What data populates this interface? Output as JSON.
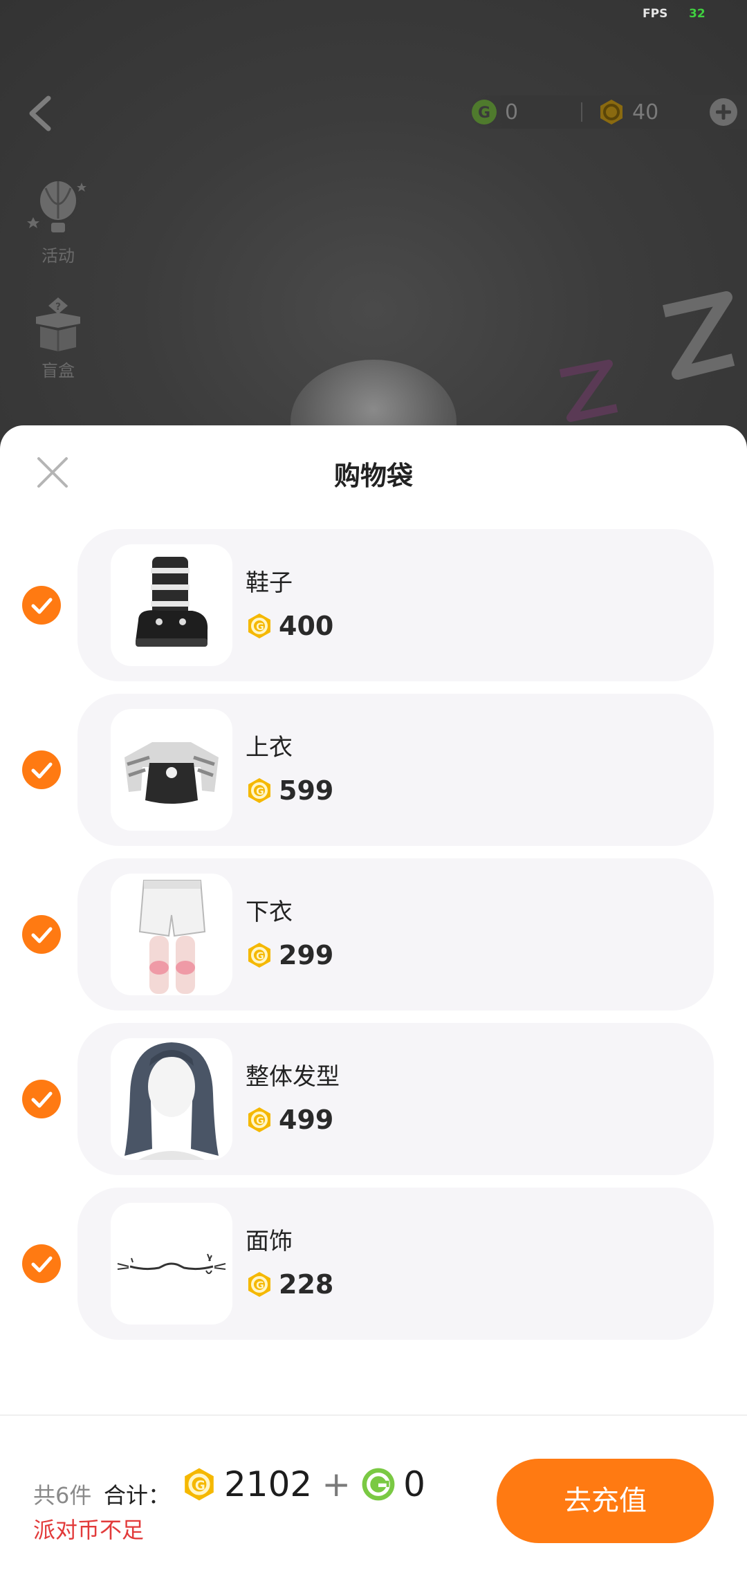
{
  "status": {
    "fps_label": "FPS",
    "fps_value": "32"
  },
  "topbar": {
    "back_icon": "chevron-left-icon",
    "green_coin_value": "0",
    "gold_coin_value": "40",
    "add_icon": "plus-icon"
  },
  "side_menu": [
    {
      "label": "活动",
      "icon": "hot-air-balloon-icon"
    },
    {
      "label": "盲盒",
      "icon": "mystery-box-icon"
    }
  ],
  "sheet": {
    "title": "购物袋",
    "close_icon": "close-icon",
    "items": [
      {
        "name": "鞋子",
        "price": "400",
        "checked": true,
        "thumb": "boots-thumbnail"
      },
      {
        "name": "上衣",
        "price": "599",
        "checked": true,
        "thumb": "top-thumbnail"
      },
      {
        "name": "下衣",
        "price": "299",
        "checked": true,
        "thumb": "shorts-thumbnail"
      },
      {
        "name": "整体发型",
        "price": "499",
        "checked": true,
        "thumb": "hairstyle-thumbnail"
      },
      {
        "name": "面饰",
        "price": "228",
        "checked": true,
        "thumb": "face-accessory-thumbnail"
      }
    ]
  },
  "footer": {
    "count_label": "共6件",
    "total_label": "合计：",
    "gold_total": "2102",
    "plus_sign": "+",
    "green_total": "0",
    "warning": "派对币不足",
    "recharge_label": "去充值"
  },
  "colors": {
    "accent": "#ff7a12",
    "warning": "#e23a3a",
    "gold_coin": "#f5b800",
    "green_coin": "#7ac943"
  }
}
